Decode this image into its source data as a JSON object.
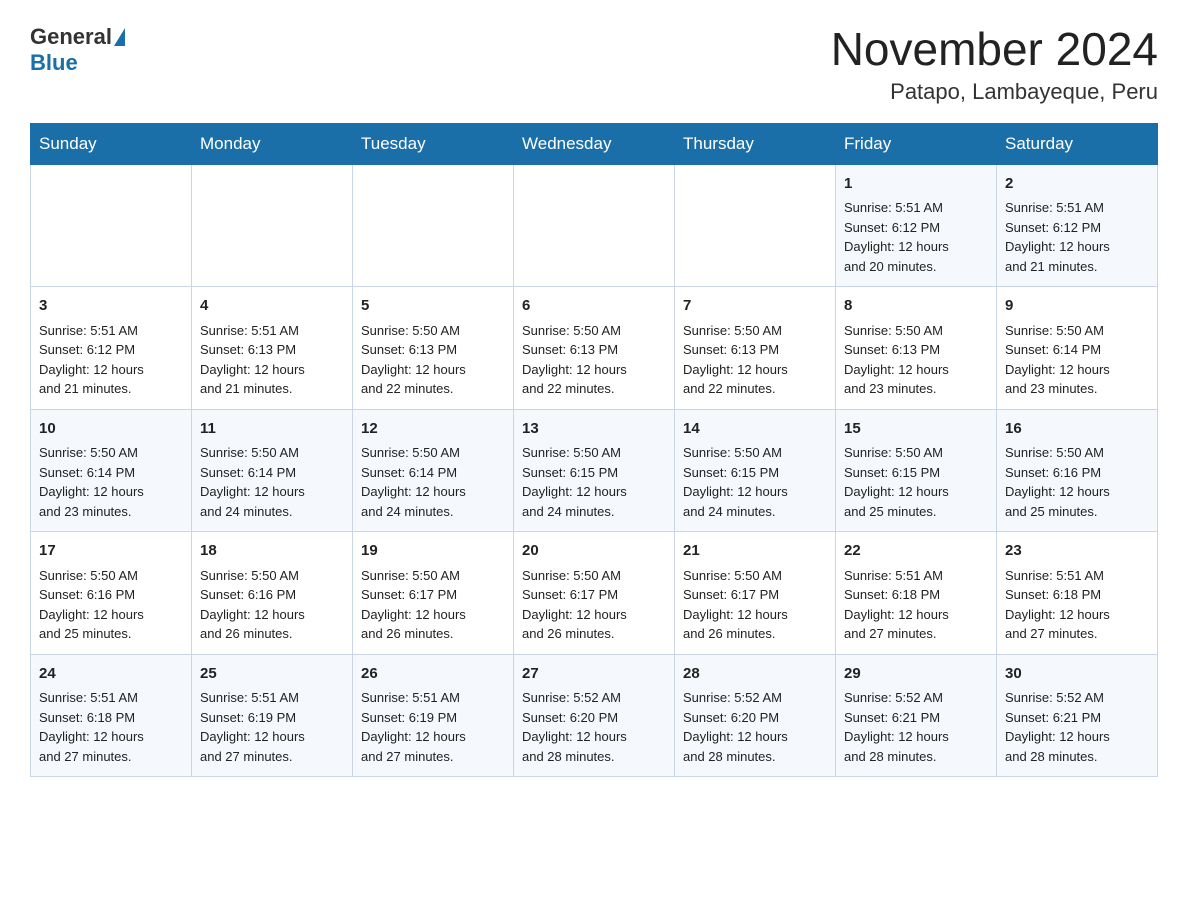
{
  "header": {
    "logo_text_general": "General",
    "logo_text_blue": "Blue",
    "title": "November 2024",
    "subtitle": "Patapo, Lambayeque, Peru"
  },
  "days_of_week": [
    "Sunday",
    "Monday",
    "Tuesday",
    "Wednesday",
    "Thursday",
    "Friday",
    "Saturday"
  ],
  "weeks": [
    [
      {
        "day": "",
        "info": ""
      },
      {
        "day": "",
        "info": ""
      },
      {
        "day": "",
        "info": ""
      },
      {
        "day": "",
        "info": ""
      },
      {
        "day": "",
        "info": ""
      },
      {
        "day": "1",
        "info": "Sunrise: 5:51 AM\nSunset: 6:12 PM\nDaylight: 12 hours\nand 20 minutes."
      },
      {
        "day": "2",
        "info": "Sunrise: 5:51 AM\nSunset: 6:12 PM\nDaylight: 12 hours\nand 21 minutes."
      }
    ],
    [
      {
        "day": "3",
        "info": "Sunrise: 5:51 AM\nSunset: 6:12 PM\nDaylight: 12 hours\nand 21 minutes."
      },
      {
        "day": "4",
        "info": "Sunrise: 5:51 AM\nSunset: 6:13 PM\nDaylight: 12 hours\nand 21 minutes."
      },
      {
        "day": "5",
        "info": "Sunrise: 5:50 AM\nSunset: 6:13 PM\nDaylight: 12 hours\nand 22 minutes."
      },
      {
        "day": "6",
        "info": "Sunrise: 5:50 AM\nSunset: 6:13 PM\nDaylight: 12 hours\nand 22 minutes."
      },
      {
        "day": "7",
        "info": "Sunrise: 5:50 AM\nSunset: 6:13 PM\nDaylight: 12 hours\nand 22 minutes."
      },
      {
        "day": "8",
        "info": "Sunrise: 5:50 AM\nSunset: 6:13 PM\nDaylight: 12 hours\nand 23 minutes."
      },
      {
        "day": "9",
        "info": "Sunrise: 5:50 AM\nSunset: 6:14 PM\nDaylight: 12 hours\nand 23 minutes."
      }
    ],
    [
      {
        "day": "10",
        "info": "Sunrise: 5:50 AM\nSunset: 6:14 PM\nDaylight: 12 hours\nand 23 minutes."
      },
      {
        "day": "11",
        "info": "Sunrise: 5:50 AM\nSunset: 6:14 PM\nDaylight: 12 hours\nand 24 minutes."
      },
      {
        "day": "12",
        "info": "Sunrise: 5:50 AM\nSunset: 6:14 PM\nDaylight: 12 hours\nand 24 minutes."
      },
      {
        "day": "13",
        "info": "Sunrise: 5:50 AM\nSunset: 6:15 PM\nDaylight: 12 hours\nand 24 minutes."
      },
      {
        "day": "14",
        "info": "Sunrise: 5:50 AM\nSunset: 6:15 PM\nDaylight: 12 hours\nand 24 minutes."
      },
      {
        "day": "15",
        "info": "Sunrise: 5:50 AM\nSunset: 6:15 PM\nDaylight: 12 hours\nand 25 minutes."
      },
      {
        "day": "16",
        "info": "Sunrise: 5:50 AM\nSunset: 6:16 PM\nDaylight: 12 hours\nand 25 minutes."
      }
    ],
    [
      {
        "day": "17",
        "info": "Sunrise: 5:50 AM\nSunset: 6:16 PM\nDaylight: 12 hours\nand 25 minutes."
      },
      {
        "day": "18",
        "info": "Sunrise: 5:50 AM\nSunset: 6:16 PM\nDaylight: 12 hours\nand 26 minutes."
      },
      {
        "day": "19",
        "info": "Sunrise: 5:50 AM\nSunset: 6:17 PM\nDaylight: 12 hours\nand 26 minutes."
      },
      {
        "day": "20",
        "info": "Sunrise: 5:50 AM\nSunset: 6:17 PM\nDaylight: 12 hours\nand 26 minutes."
      },
      {
        "day": "21",
        "info": "Sunrise: 5:50 AM\nSunset: 6:17 PM\nDaylight: 12 hours\nand 26 minutes."
      },
      {
        "day": "22",
        "info": "Sunrise: 5:51 AM\nSunset: 6:18 PM\nDaylight: 12 hours\nand 27 minutes."
      },
      {
        "day": "23",
        "info": "Sunrise: 5:51 AM\nSunset: 6:18 PM\nDaylight: 12 hours\nand 27 minutes."
      }
    ],
    [
      {
        "day": "24",
        "info": "Sunrise: 5:51 AM\nSunset: 6:18 PM\nDaylight: 12 hours\nand 27 minutes."
      },
      {
        "day": "25",
        "info": "Sunrise: 5:51 AM\nSunset: 6:19 PM\nDaylight: 12 hours\nand 27 minutes."
      },
      {
        "day": "26",
        "info": "Sunrise: 5:51 AM\nSunset: 6:19 PM\nDaylight: 12 hours\nand 27 minutes."
      },
      {
        "day": "27",
        "info": "Sunrise: 5:52 AM\nSunset: 6:20 PM\nDaylight: 12 hours\nand 28 minutes."
      },
      {
        "day": "28",
        "info": "Sunrise: 5:52 AM\nSunset: 6:20 PM\nDaylight: 12 hours\nand 28 minutes."
      },
      {
        "day": "29",
        "info": "Sunrise: 5:52 AM\nSunset: 6:21 PM\nDaylight: 12 hours\nand 28 minutes."
      },
      {
        "day": "30",
        "info": "Sunrise: 5:52 AM\nSunset: 6:21 PM\nDaylight: 12 hours\nand 28 minutes."
      }
    ]
  ]
}
